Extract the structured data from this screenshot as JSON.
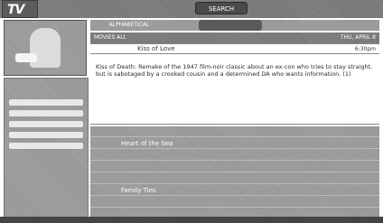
{
  "header": {
    "logo_text": "TV",
    "nav": [
      "",
      "",
      "",
      "SEARCH",
      "",
      ""
    ],
    "active_nav_index": 3
  },
  "subnav": {
    "items": [
      "ALPHABETICAL",
      "",
      ""
    ],
    "active_index": 1
  },
  "sidebar": {
    "heading": "",
    "buttons": [
      "",
      "",
      "",
      "",
      ""
    ]
  },
  "detail": {
    "category": "MOVIES ALL",
    "date": "THU, APRIL 8",
    "channel": "",
    "title": "Kiss of Love",
    "time": "6:30pm",
    "info_icons": "",
    "synopsis": "Kiss of Death: Remake of the 1947 film-noir classic about an ex-con who tries to stay straight, but is sabotaged by a crooked cousin and a determined DA who wants information. (1)"
  },
  "listings": [
    {
      "icon": "",
      "title": "",
      "time": ""
    },
    {
      "icon": "",
      "title": "Heart of the Sea",
      "time": ""
    },
    {
      "icon": "",
      "title": "",
      "time": ""
    },
    {
      "icon": "",
      "title": "",
      "time": ""
    },
    {
      "icon": "",
      "title": "",
      "time": ""
    },
    {
      "icon": "",
      "title": "Family Ties",
      "time": ""
    },
    {
      "icon": "",
      "title": "",
      "time": ""
    }
  ]
}
